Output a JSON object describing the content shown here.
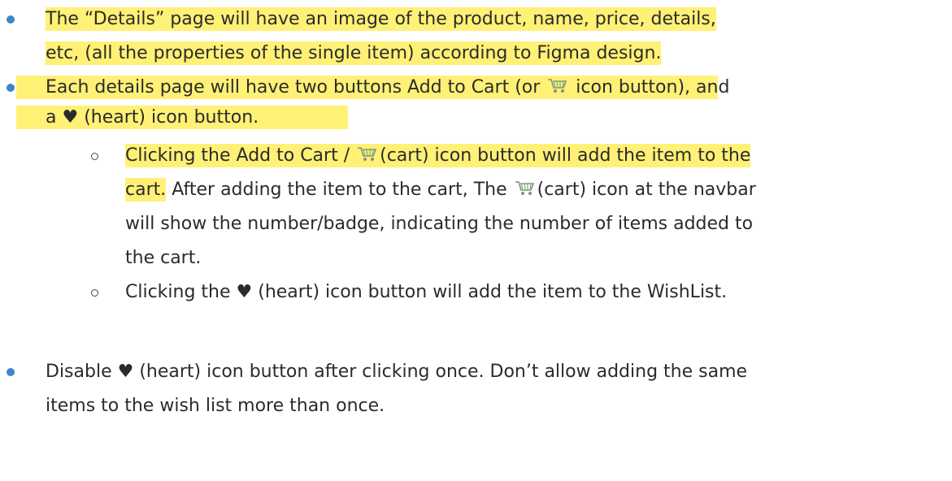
{
  "bullet1": {
    "line1": "The “Details” page will have an image of the product, name, price, details,",
    "line2": "etc, (all the properties of the single item) according to Figma design."
  },
  "bullet2": {
    "line1_a": "Each details page will have two buttons Add to Cart (or ",
    "line1_b": " icon button), an",
    "line1_c": "d",
    "line2": "a ♥ (heart) icon button.",
    "sub1": {
      "line1_a": "Clicking the Add to Cart / ",
      "line1_b": "(cart) icon button will add the item to the",
      "line2_a": "cart.",
      "line2_b": " After adding the item to the cart, The ",
      "line2_c": "(cart) icon at the navbar",
      "line3": "will show the number/badge, indicating the number of items added to",
      "line4": "the cart."
    },
    "sub2": {
      "line1": "Clicking the ♥ (heart) icon button will add the item to the WishList."
    }
  },
  "bullet3": {
    "line1": "Disable ♥ (heart) icon button after clicking once. Don’t allow adding the same",
    "line2": "items to the wish list more than once."
  },
  "icons": [
    "cart-icon",
    "heart-icon"
  ],
  "colors": {
    "highlight": "#fff176",
    "bullet": "#3d85c6",
    "text": "#2b2b2b"
  }
}
